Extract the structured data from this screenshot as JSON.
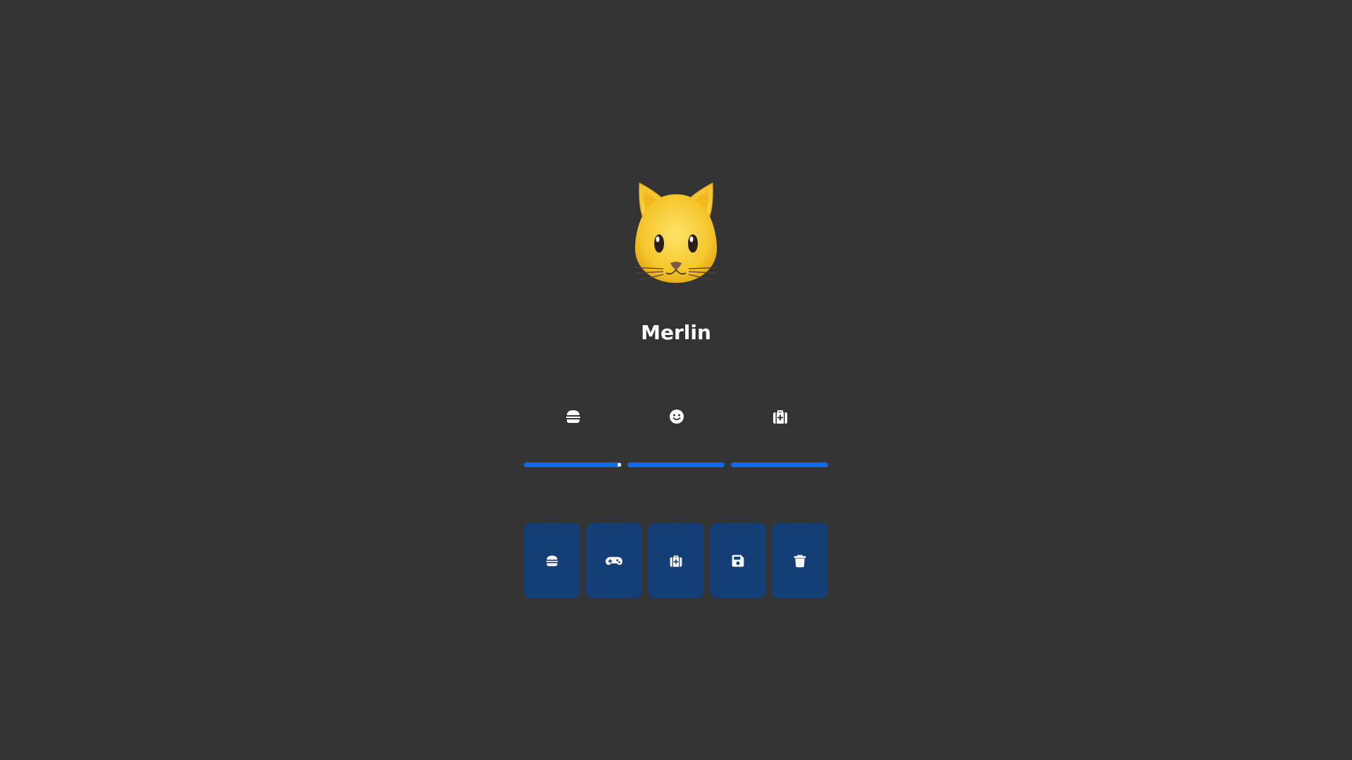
{
  "pet": {
    "name": "Merlin",
    "avatar": "cat-face-emoji"
  },
  "stats": [
    {
      "name": "hunger",
      "icon": "burger-icon",
      "value": 100
    },
    {
      "name": "happiness",
      "icon": "smile-icon",
      "value": 100
    },
    {
      "name": "health",
      "icon": "medkit-icon",
      "value": 100
    }
  ],
  "actions": [
    {
      "name": "feed",
      "icon": "burger-icon"
    },
    {
      "name": "play",
      "icon": "gamepad-icon"
    },
    {
      "name": "heal",
      "icon": "medkit-icon"
    },
    {
      "name": "save",
      "icon": "floppy-disk-icon"
    },
    {
      "name": "delete",
      "icon": "trash-icon"
    }
  ],
  "colors": {
    "background": "#333333",
    "button": "#133e76",
    "bar_fill": "#1469e8",
    "text": "#ffffff"
  }
}
